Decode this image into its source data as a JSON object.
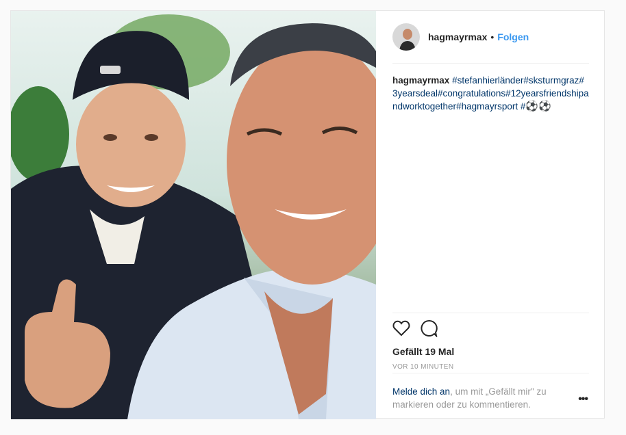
{
  "post": {
    "username": "hagmayrmax",
    "separator": "•",
    "follow_label": "Folgen",
    "caption_user": "hagmayrmax",
    "caption_tags": "#stefanhierländer#sksturmgraz#3yearsdeal#congratulations#12yearsfriendshipandworktogether#hagmayrsport #",
    "caption_emoji": "⚽⚽",
    "likes": "Gefällt 19 Mal",
    "time": "VOR 10 MINUTEN",
    "login_link": "Melde dich an",
    "login_text": ", um mit „Gefällt mir\" zu markieren oder zu kommentieren.",
    "more_label": "•••"
  },
  "icons": {
    "like": "heart-icon",
    "comment": "comment-icon"
  },
  "colors": {
    "link": "#3897f0",
    "hashtag": "#003569",
    "muted": "#999999"
  }
}
